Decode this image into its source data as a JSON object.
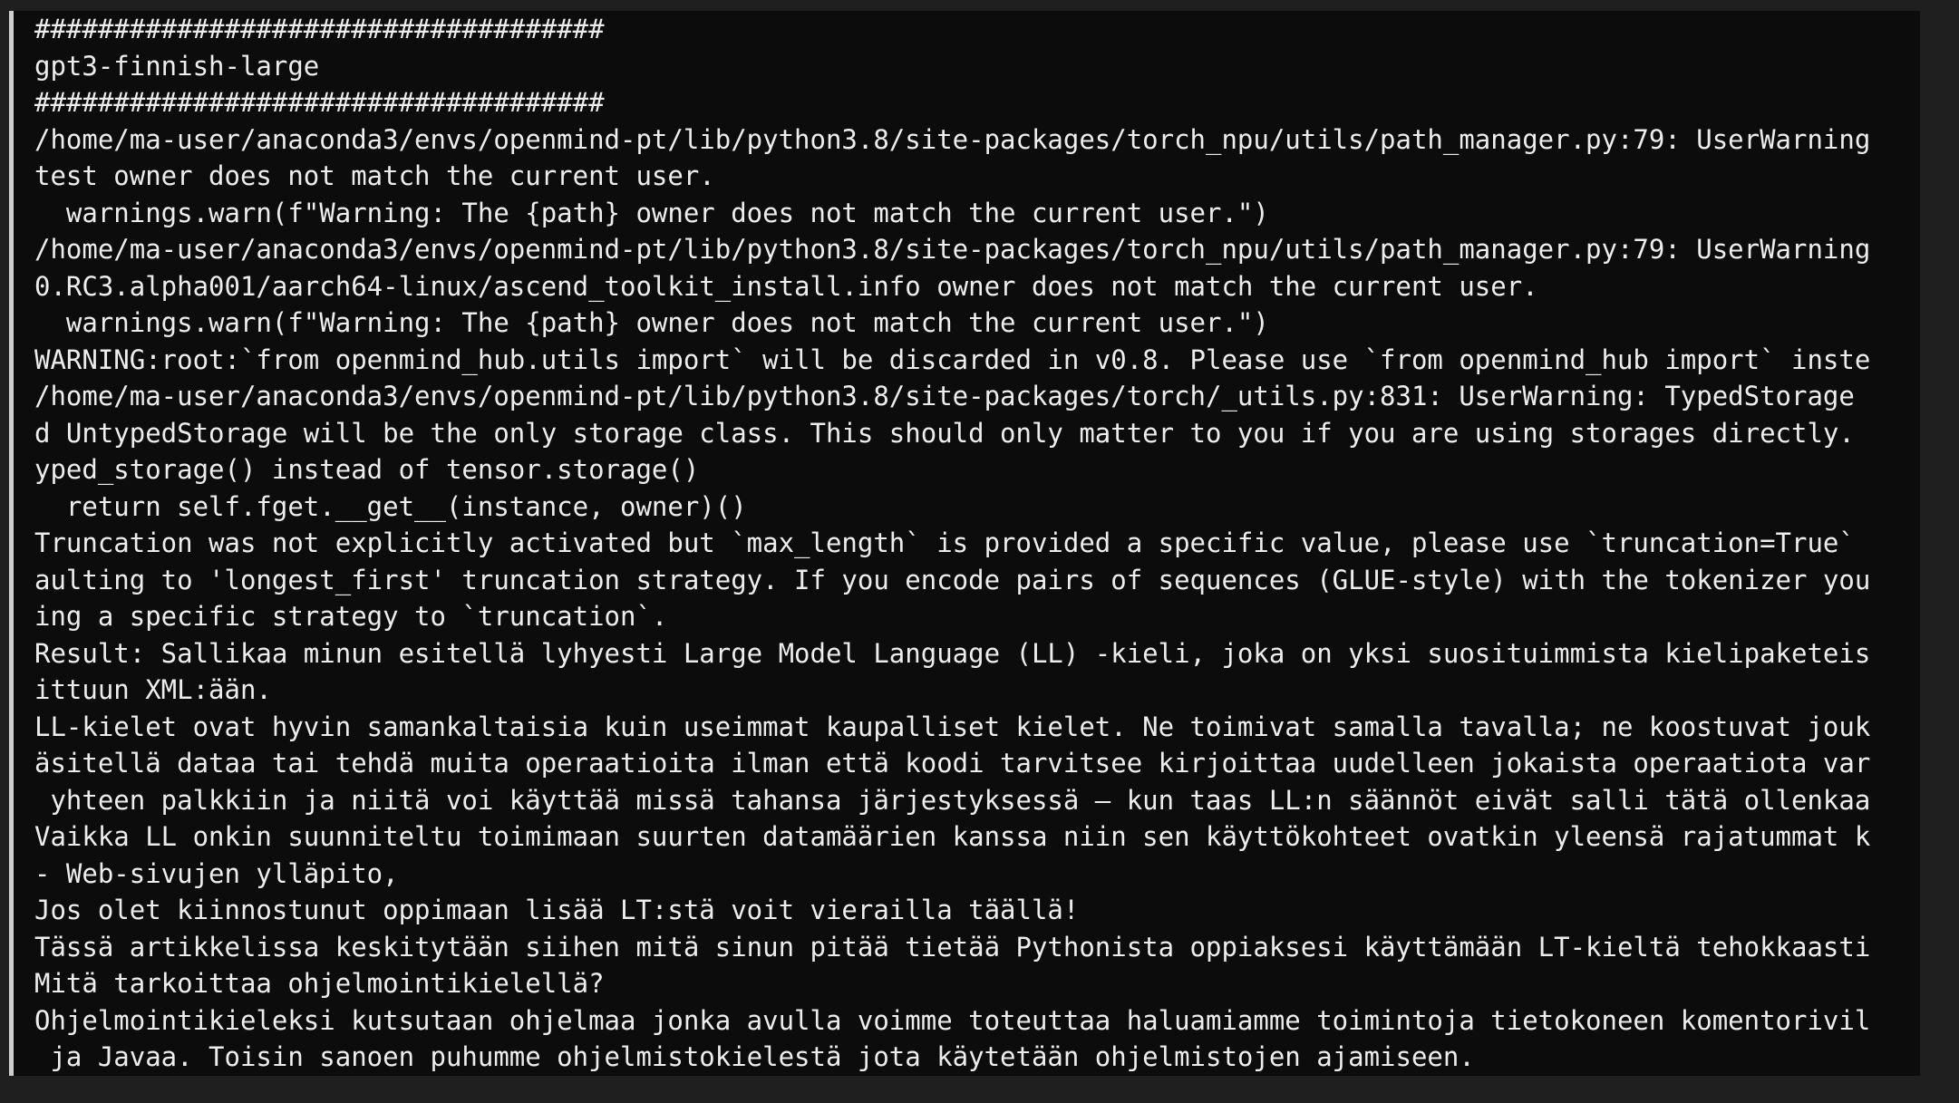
{
  "terminal": {
    "lines": [
      "####################################",
      "gpt3-finnish-large",
      "####################################",
      "/home/ma-user/anaconda3/envs/openmind-pt/lib/python3.8/site-packages/torch_npu/utils/path_manager.py:79: UserWarning",
      "test owner does not match the current user.",
      "  warnings.warn(f\"Warning: The {path} owner does not match the current user.\")",
      "/home/ma-user/anaconda3/envs/openmind-pt/lib/python3.8/site-packages/torch_npu/utils/path_manager.py:79: UserWarning",
      "0.RC3.alpha001/aarch64-linux/ascend_toolkit_install.info owner does not match the current user.",
      "  warnings.warn(f\"Warning: The {path} owner does not match the current user.\")",
      "WARNING:root:`from openmind_hub.utils import` will be discarded in v0.8. Please use `from openmind_hub import` inste",
      "/home/ma-user/anaconda3/envs/openmind-pt/lib/python3.8/site-packages/torch/_utils.py:831: UserWarning: TypedStorage",
      "d UntypedStorage will be the only storage class. This should only matter to you if you are using storages directly.",
      "yped_storage() instead of tensor.storage()",
      "  return self.fget.__get__(instance, owner)()",
      "Truncation was not explicitly activated but `max_length` is provided a specific value, please use `truncation=True`",
      "aulting to 'longest_first' truncation strategy. If you encode pairs of sequences (GLUE-style) with the tokenizer you",
      "ing a specific strategy to `truncation`.",
      "Result: Sallikaa minun esitellä lyhyesti Large Model Language (LL) -kieli, joka on yksi suosituimmista kielipaketeis",
      "ittuun XML:ään.",
      "LL-kielet ovat hyvin samankaltaisia kuin useimmat kaupalliset kielet. Ne toimivat samalla tavalla; ne koostuvat jouk",
      "äsitellä dataa tai tehdä muita operaatioita ilman että koodi tarvitsee kirjoittaa uudelleen jokaista operaatiota var",
      " yhteen palkkiin ja niitä voi käyttää missä tahansa järjestyksessä – kun taas LL:n säännöt eivät salli tätä ollenkaa",
      "Vaikka LL onkin suunniteltu toimimaan suurten datamäärien kanssa niin sen käyttökohteet ovatkin yleensä rajatummat k",
      "- Web-sivujen ylläpito,",
      "Jos olet kiinnostunut oppimaan lisää LT:stä voit vierailla täällä!",
      "Tässä artikkelissa keskitytään siihen mitä sinun pitää tietää Pythonista oppiaksesi käyttämään LT-kieltä tehokkaasti",
      "Mitä tarkoittaa ohjelmointikielellä?",
      "Ohjelmointikieleksi kutsutaan ohjelmaa jonka avulla voimme toteuttaa haluamiamme toimintoja tietokoneen komentorivil",
      " ja Javaa. Toisin sanoen puhumme ohjelmistokielestä jota käytetään ohjelmistojen ajamiseen."
    ]
  },
  "colors": {
    "terminal_bg": "#0c0c0c",
    "text": "#ededed",
    "outer_bg": "#1f1f1f",
    "left_rule": "#cfcfcf"
  }
}
